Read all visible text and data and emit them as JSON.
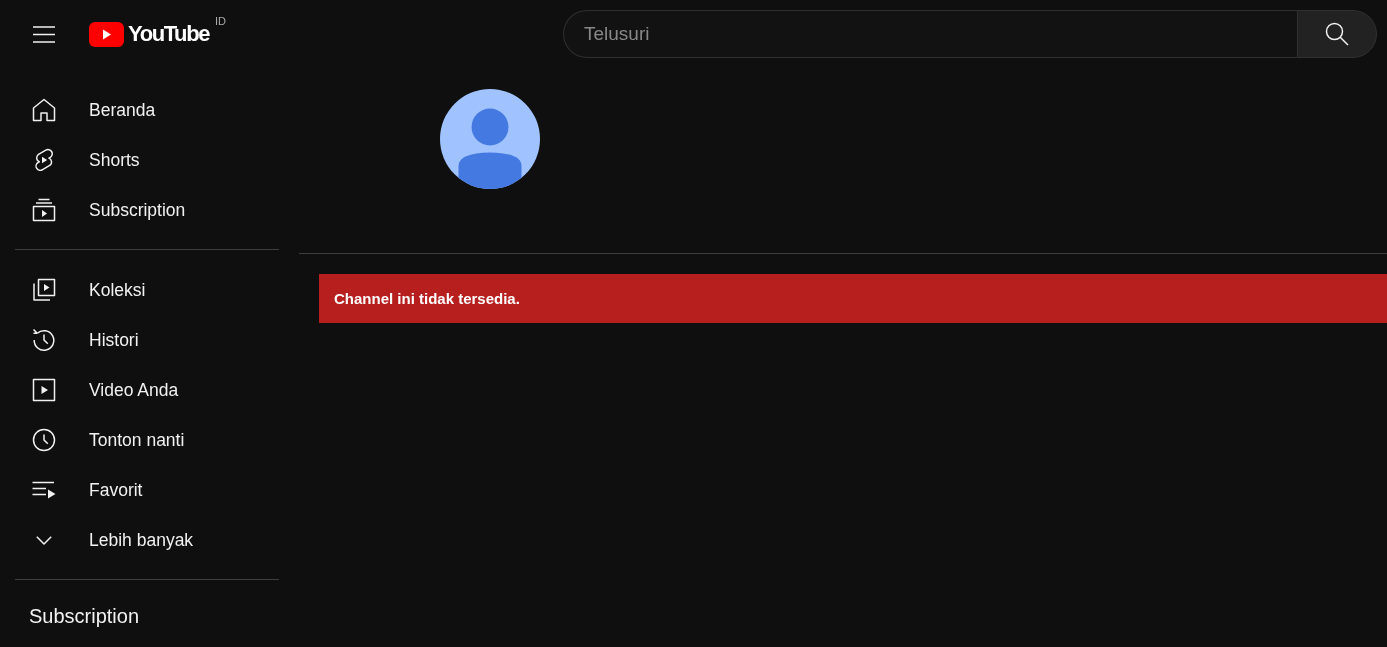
{
  "header": {
    "logo_text": "YouTube",
    "country_code": "ID",
    "search": {
      "placeholder": "Telusuri"
    }
  },
  "sidebar": {
    "sections": [
      {
        "items": [
          {
            "label": "Beranda",
            "kind": "home",
            "selected": false
          },
          {
            "label": "Shorts",
            "kind": "shorts",
            "selected": false
          },
          {
            "label": "Subscription",
            "kind": "subscriptions",
            "selected": false
          }
        ]
      },
      {
        "items": [
          {
            "label": "Koleksi",
            "kind": "library",
            "selected": false
          },
          {
            "label": "Histori",
            "kind": "history",
            "selected": false
          },
          {
            "label": "Video Anda",
            "kind": "videos",
            "selected": false
          },
          {
            "label": "Tonton nanti",
            "kind": "watch_later",
            "selected": false
          },
          {
            "label": "Favorit",
            "kind": "playlist",
            "selected": false
          },
          {
            "label": "Lebih banyak",
            "kind": "more",
            "selected": false
          }
        ]
      }
    ],
    "heading": "Subscription"
  },
  "channel": {
    "message": "Channel ini tidak tersedia."
  }
}
